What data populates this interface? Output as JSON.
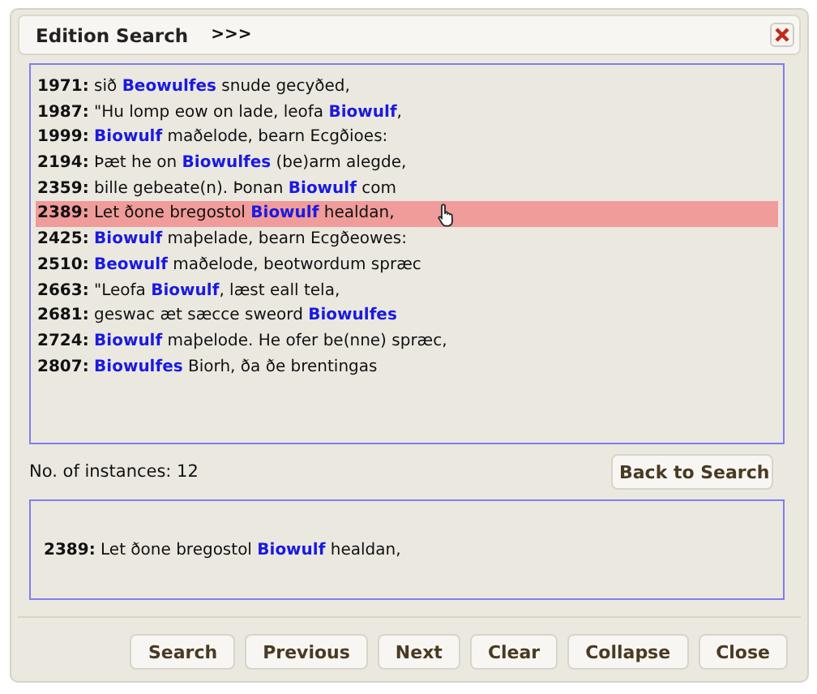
{
  "dialog": {
    "title": "Edition Search",
    "expand_label": ">>>"
  },
  "results": [
    {
      "line": "1971:",
      "text": "sið **Beowulfes** snude gecyðed,",
      "selected": false
    },
    {
      "line": "1987:",
      "text": "\"Hu lomp eow on lade, leofa **Biowulf**,",
      "selected": false
    },
    {
      "line": "1999:",
      "text": "**Biowulf** maðelode, bearn Ecgðioes:",
      "selected": false
    },
    {
      "line": "2194:",
      "text": "Þæt he on **Biowulfes** (be)arm alegde,",
      "selected": false
    },
    {
      "line": "2359:",
      "text": "bille gebeate(n). Þonan **Biowulf** com",
      "selected": false
    },
    {
      "line": "2389:",
      "text": "Let ðone bregostol **Biowulf** healdan,",
      "selected": true
    },
    {
      "line": "2425:",
      "text": "**Biowulf** maþelade, bearn Ecgðeowes:",
      "selected": false
    },
    {
      "line": "2510:",
      "text": "**Beowulf** maðelode, beotwordum spræc",
      "selected": false
    },
    {
      "line": "2663:",
      "text": "\"Leofa **Biowulf**, læst eall tela,",
      "selected": false
    },
    {
      "line": "2681:",
      "text": "geswac æt sæcce sweord **Biowulfes**",
      "selected": false
    },
    {
      "line": "2724:",
      "text": "**Biowulf** maþelode. He ofer be(nne) spræc,",
      "selected": false
    },
    {
      "line": "2807:",
      "text": "**Biowulfes** Biorh, ða ðe brentingas",
      "selected": false
    }
  ],
  "instances": "No. of instances: 12",
  "back_button": "Back to Search",
  "detail": {
    "line": "2389:",
    "text": "Let ðone bregostol **Biowulf** healdan,"
  },
  "buttons": [
    "Search",
    "Previous",
    "Next",
    "Clear",
    "Collapse",
    "Close"
  ]
}
